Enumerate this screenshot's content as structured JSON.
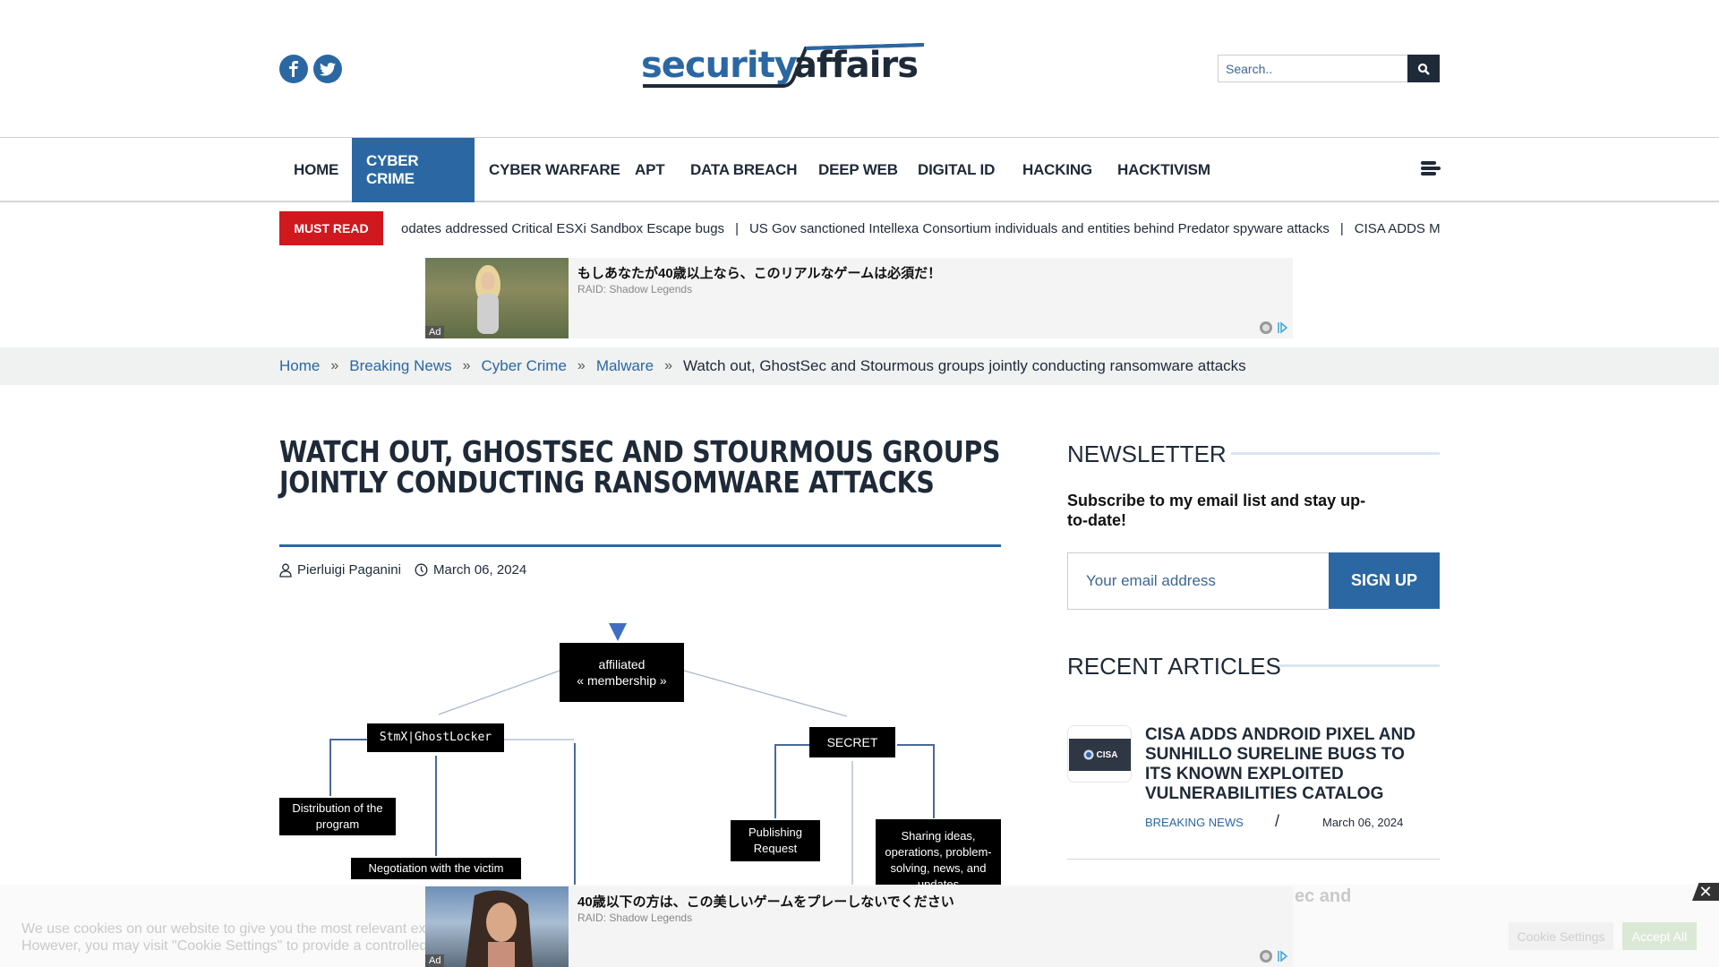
{
  "header": {
    "social": [
      {
        "name": "facebook",
        "glyph": "f"
      },
      {
        "name": "twitter",
        "glyph": "t"
      }
    ],
    "logo": {
      "part1": "security",
      "part2": "affairs"
    },
    "search": {
      "placeholder": "Search.."
    }
  },
  "nav": {
    "items": [
      {
        "label": "HOME",
        "active": false
      },
      {
        "label": "CYBER CRIME",
        "active": true
      },
      {
        "label": "CYBER WARFARE",
        "active": false
      },
      {
        "label": "APT",
        "active": false
      },
      {
        "label": "DATA BREACH",
        "active": false
      },
      {
        "label": "DEEP WEB",
        "active": false
      },
      {
        "label": "DIGITAL ID",
        "active": false
      },
      {
        "label": "HACKING",
        "active": false
      },
      {
        "label": "HACKTIVISM",
        "active": false
      }
    ]
  },
  "must_read": {
    "label": "MUST READ",
    "headlines": [
      "odates addressed Critical ESXi Sandbox Escape bugs",
      "US Gov sanctioned Intellexa Consortium individuals and entities behind Predator spyware attacks",
      "CISA ADDS MICROSOI"
    ],
    "separator": "|"
  },
  "ads": [
    {
      "title": "もしあなたが40歳以上なら、このリアルなゲームは必須だ！",
      "source": "RAID: Shadow Legends",
      "tag": "Ad"
    },
    {
      "title": "40歳以下の方は、この美しいゲームをプレーしないでください",
      "source": "RAID: Shadow Legends",
      "tag": "Ad"
    }
  ],
  "breadcrumb": {
    "items": [
      "Home",
      "Breaking News",
      "Cyber Crime",
      "Malware"
    ],
    "current": "Watch out, GhostSec and Stourmous groups jointly conducting ransomware attacks",
    "separator": "»"
  },
  "article": {
    "title": "WATCH OUT, GHOSTSEC AND STOURMOUS GROUPS JOINTLY CONDUCTING RANSOMWARE ATTACKS",
    "author": "Pierluigi Paganini",
    "date": "March 06, 2024",
    "diagram": {
      "root": "affiliated\n« membership »",
      "left": "StmX|GhostLocker",
      "right": "SECRET",
      "left_children": [
        "Distribution of the program",
        "Negotiation with the victim"
      ],
      "right_children": [
        "Publishing Request",
        "Sharing ideas, operations, problem-solving, news, and updates"
      ]
    }
  },
  "sidebar": {
    "newsletter": {
      "heading": "NEWSLETTER",
      "subtitle": "Subscribe to my email list and stay up-to-date!",
      "email_placeholder": "Your email address",
      "button": "SIGN UP"
    },
    "recent": {
      "heading": "RECENT ARTICLES",
      "items": [
        {
          "thumb_label": "CISA",
          "title": "CISA ADDS ANDROID PIXEL AND SUNHILLO SURELINE BUGS TO ITS KNOWN EXPLOITED VULNERABILITIES CATALOG",
          "category": "BREAKING NEWS",
          "slash": "/",
          "date": "March 06, 2024"
        }
      ],
      "next_peek": "ec and"
    }
  },
  "cookie": {
    "line1": "We use cookies on our website to give you the most relevant expe",
    "line2": "However, you may visit \"Cookie Settings\" to provide a controlled co",
    "settings": "Cookie Settings",
    "accept": "Accept All",
    "close": "✕"
  },
  "colors": {
    "brand_blue": "#2b67a3",
    "dark": "#1f2a38",
    "must_read_red": "#d0181f"
  }
}
